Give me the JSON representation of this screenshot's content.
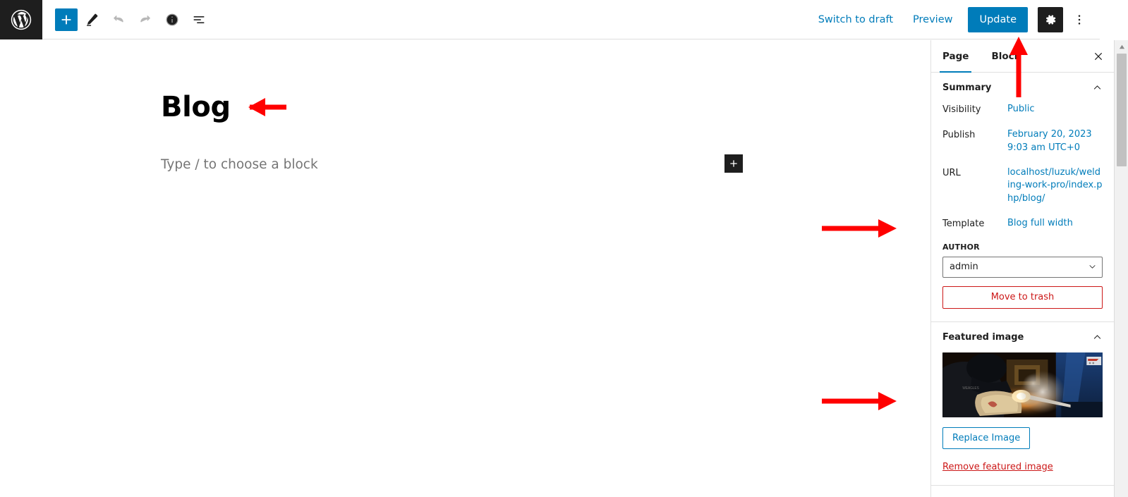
{
  "header": {
    "logo_icon": "wordpress-logo",
    "tools": [
      {
        "name": "block-inserter",
        "icon": "plus-icon",
        "state": "primary"
      },
      {
        "name": "edit-mode",
        "icon": "pencil-icon",
        "state": "normal"
      },
      {
        "name": "undo",
        "icon": "undo-arrow-icon",
        "state": "disabled"
      },
      {
        "name": "redo",
        "icon": "redo-arrow-icon",
        "state": "disabled"
      },
      {
        "name": "details",
        "icon": "info-circle-icon",
        "state": "normal"
      },
      {
        "name": "list-view",
        "icon": "list-view-icon",
        "state": "normal"
      }
    ],
    "switch_to_draft": "Switch to draft",
    "preview": "Preview",
    "update": "Update",
    "settings_icon": "gear-icon",
    "options_icon": "three-dots-vertical-icon"
  },
  "editor": {
    "title": "Blog",
    "placeholder": "Type / to choose a block",
    "inserter_icon": "plus-icon"
  },
  "sidebar": {
    "tabs": [
      {
        "label": "Page",
        "active": true
      },
      {
        "label": "Block",
        "active": false
      }
    ],
    "close_icon": "close-icon",
    "summary": {
      "title": "Summary",
      "collapse_icon": "chevron-up-icon",
      "rows": [
        {
          "label": "Visibility",
          "value": "Public"
        },
        {
          "label": "Publish",
          "value": "February 20, 2023 9:03 am UTC+0"
        },
        {
          "label": "URL",
          "value": "localhost/luzuk/welding-work-pro/index.php/blog/"
        },
        {
          "label": "Template",
          "value": "Blog full width"
        }
      ],
      "author_label": "AUTHOR",
      "author_value": "admin",
      "author_dropdown_icon": "chevron-down-icon",
      "trash_label": "Move to trash"
    },
    "featured_image": {
      "title": "Featured image",
      "collapse_icon": "chevron-up-icon",
      "image_alt": "welder-working-photo",
      "replace_label": "Replace Image",
      "remove_label": "Remove featured image"
    }
  },
  "scrollbar": {
    "up_arrow_icon": "scroll-up-arrow-icon"
  },
  "annotations": [
    {
      "name": "arrow-to-title",
      "direction": "left"
    },
    {
      "name": "arrow-to-update-button",
      "direction": "up"
    },
    {
      "name": "arrow-to-template-row",
      "direction": "right"
    },
    {
      "name": "arrow-to-featured-image",
      "direction": "right"
    }
  ],
  "colors": {
    "accent_blue": "#007cba",
    "danger_red": "#cc1818",
    "annotation_red": "#ff0000",
    "dark": "#1e1e1e"
  }
}
